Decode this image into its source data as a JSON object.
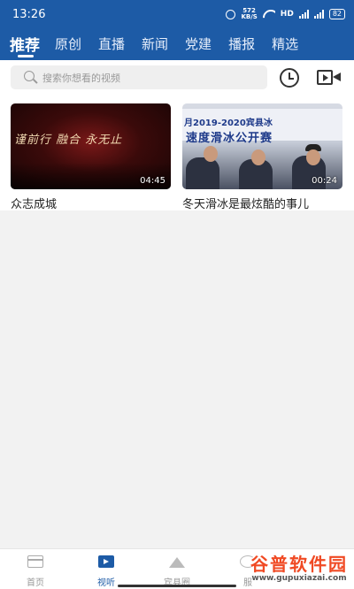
{
  "status": {
    "time": "13:26",
    "speed_top": "572",
    "speed_unit": "KB/S",
    "network": "HD",
    "signal_label": "4G",
    "battery": "82"
  },
  "tabs": [
    {
      "label": "推荐",
      "active": true
    },
    {
      "label": "原创",
      "active": false
    },
    {
      "label": "直播",
      "active": false
    },
    {
      "label": "新闻",
      "active": false
    },
    {
      "label": "党建",
      "active": false
    },
    {
      "label": "播报",
      "active": false
    },
    {
      "label": "精选",
      "active": false
    }
  ],
  "search": {
    "placeholder": "搜索你想看的视频",
    "history_icon": "clock-icon",
    "video_icon": "video-camera-icon"
  },
  "videos": [
    {
      "title": "众志成城",
      "duration": "04:45",
      "thumb_text": "谨前行  融合  永无止"
    },
    {
      "title": "冬天滑冰是最炫酷的事儿",
      "duration": "00:24",
      "thumb_line1": "月2019-2020宾县冰",
      "thumb_line2": "速度滑冰公开赛"
    }
  ],
  "bottom_nav": [
    {
      "label": "首页",
      "icon": "home-icon",
      "active": false
    },
    {
      "label": "视听",
      "icon": "tv-icon",
      "active": true
    },
    {
      "label": "宾县圈",
      "icon": "mountain-icon",
      "active": false
    },
    {
      "label": "服",
      "icon": "eye-icon",
      "active": false
    }
  ],
  "watermark": {
    "text": "谷普软件园",
    "url": "www.gupuxiazai.com"
  },
  "colors": {
    "brand": "#1d5ba6",
    "watermark": "#f04a24"
  }
}
